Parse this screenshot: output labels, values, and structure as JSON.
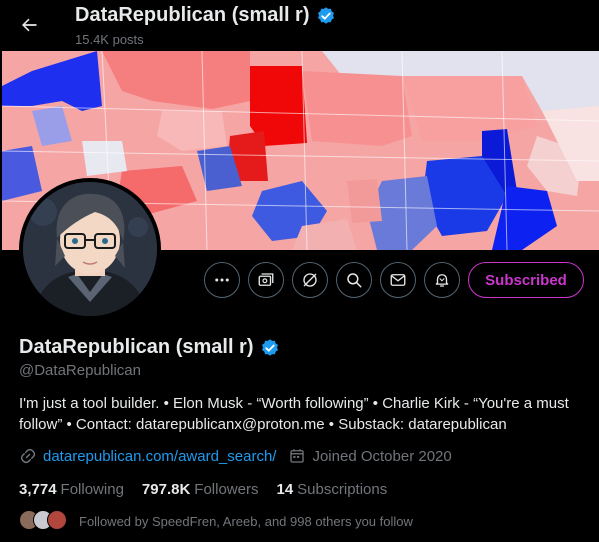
{
  "header": {
    "name": "DataRepublican (small r)",
    "posts": "15.4K posts"
  },
  "actions": {
    "subscribed_label": "Subscribed"
  },
  "profile": {
    "name": "DataRepublican (small r)",
    "handle": "@DataRepublican",
    "bio": "I'm just a tool builder. • Elon Musk - “Worth following” • Charlie Kirk - “You're a must follow” • Contact: datarepublicanx@proton.me • Substack: datarepublican",
    "website": "datarepublican.com/award_search/",
    "joined": "Joined October 2020"
  },
  "stats": {
    "following_count": "3,774",
    "following_label": "Following",
    "followers_count": "797.8K",
    "followers_label": "Followers",
    "subscriptions_count": "14",
    "subscriptions_label": "Subscriptions"
  },
  "followed_by": "Followed by SpeedFren, Areeb, and 998 others you follow",
  "colors": {
    "accent_blue": "#1d9bf0",
    "subscribed_purple": "#c936cc",
    "muted_text": "#71767b"
  }
}
